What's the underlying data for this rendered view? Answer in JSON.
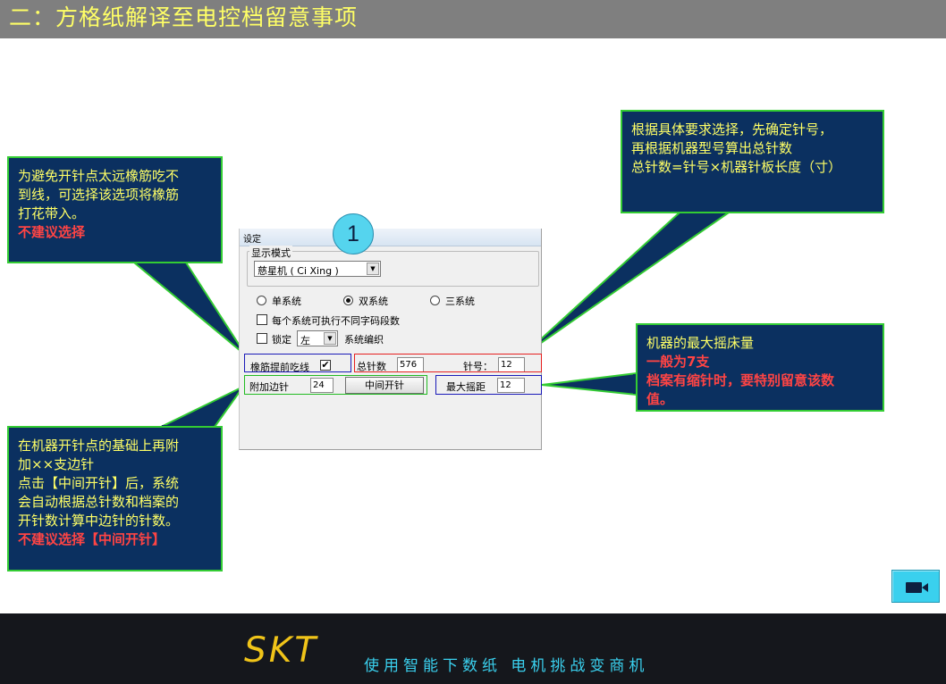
{
  "page": {
    "title": "二：方格纸解译至电控档留意事项"
  },
  "callouts": {
    "rubber": {
      "line1": "为避免开针点太远橡筋吃不",
      "line2": "到线，可选择该选项将橡筋",
      "line3": "打花带入。",
      "warning": "不建议选择"
    },
    "needle": {
      "line1": "根据具体要求选择，先确定针号，",
      "line2": "再根据机器型号算出总针数",
      "line3": "总针数=针号×机器针板长度（寸）"
    },
    "rack": {
      "line1": "机器的最大摇床量",
      "warning1": "一般为7支",
      "warning2a": "档案有缩针时，要特别留意该数",
      "warning2b": "值。"
    },
    "extra": {
      "line1": "在机器开针点的基础上再附",
      "line2": "加××支边针",
      "line3": "点击【中间开针】后，系统",
      "line4": "会自动根据总针数和档案的",
      "line5": "开针数计算中边针的针数。",
      "warning": "不建议选择【中间开针】"
    }
  },
  "marker": {
    "number": "1"
  },
  "dialog": {
    "title": "设定",
    "display_mode_label": "显示模式",
    "display_mode_value": "慈星机 ( Ci Xing )",
    "radio_single": "单系统",
    "radio_double": "双系统",
    "radio_triple": "三系统",
    "selected_system": "双系统",
    "check_each_system": "每个系统可执行不同字码段数",
    "check_lock": "锁定",
    "lock_side_value": "左",
    "system_knit_label": "系统编织",
    "rubber_early_label": "橡筋提前吃线",
    "rubber_early_checked": "✔",
    "total_needles_label": "总针数",
    "total_needles_value": "576",
    "gauge_label": "针号：",
    "gauge_value": "12",
    "extra_needle_label": "附加边针",
    "extra_needle_value": "24",
    "center_start_button": "中间开针",
    "max_rack_label": "最大摇距",
    "max_rack_value": "12"
  },
  "footer": {
    "logo": "SKT",
    "slogan": "使用智能下数纸  电机挑战变商机"
  },
  "colors": {
    "title_bar": "#7f7f7f",
    "title_text": "#ffff66",
    "callout_bg": "#0b3060",
    "callout_border": "#33cc33",
    "callout_text": "#ffff66",
    "warning_text": "#ff4444",
    "footer_bg": "#15171c",
    "logo": "#f0c419",
    "slogan": "#3ad0ee",
    "marker": "#55d4ee"
  },
  "icons": {
    "video": "video-camera-icon",
    "dropdown": "chevron-down-icon"
  }
}
